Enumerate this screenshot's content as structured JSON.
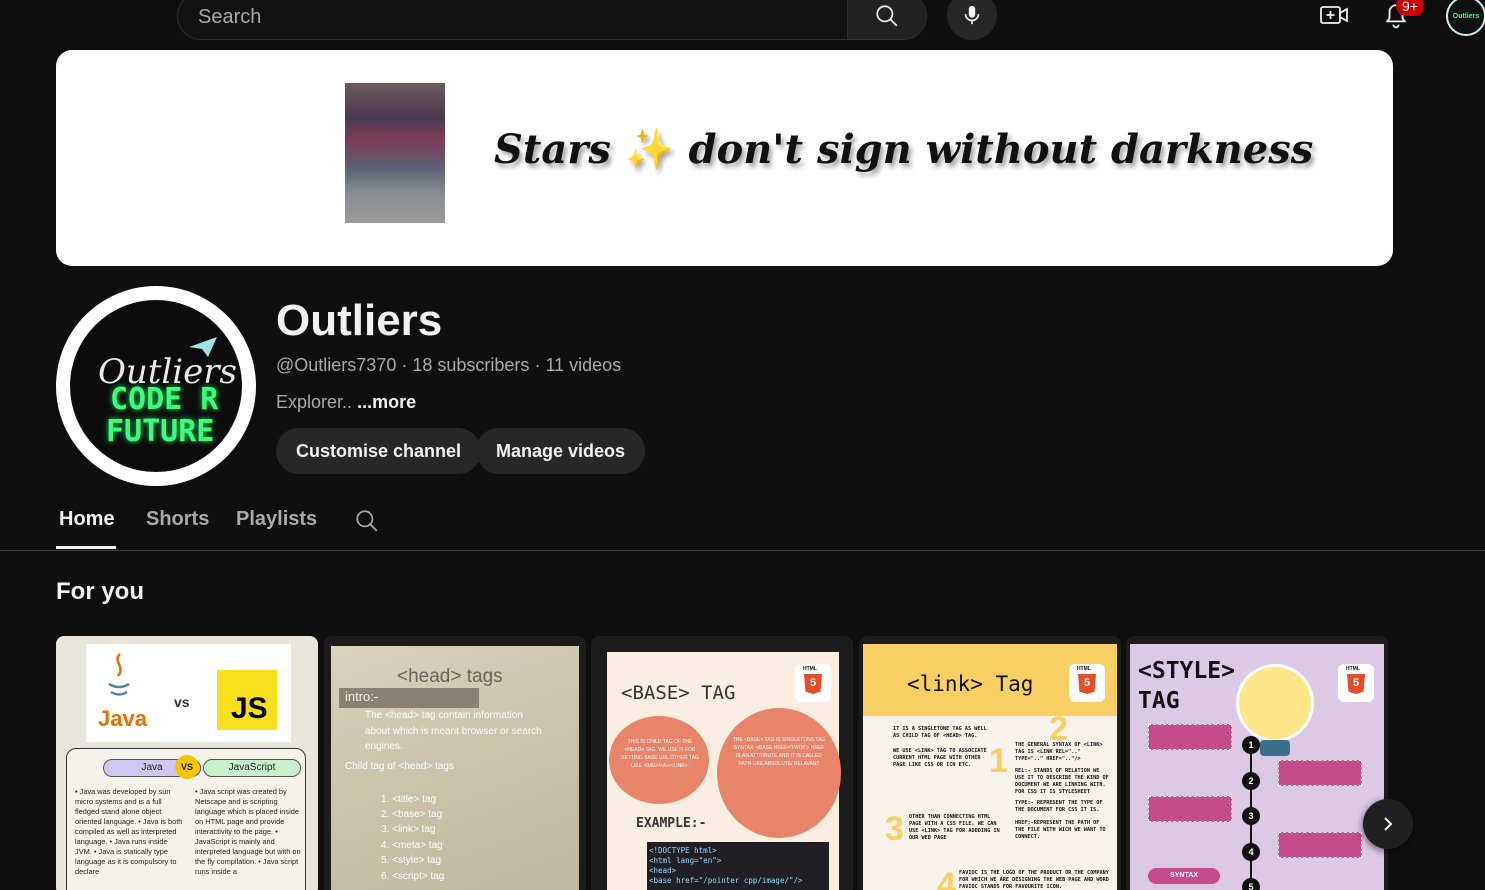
{
  "topbar": {
    "search_placeholder": "Search",
    "notifications_count": "9+",
    "icons": [
      "search-icon",
      "mic-icon",
      "create-video-icon",
      "bell-icon"
    ]
  },
  "banner": {
    "quote_part1": "Stars",
    "quote_emoji": "✨",
    "quote_part2": "don't sign without darkness"
  },
  "channel": {
    "avatar_line1": "Outliers",
    "avatar_line2": "CODE R",
    "avatar_line3": "FUTURE",
    "name": "Outliers",
    "handle": "@Outliers7370",
    "subscribers": "18 subscribers",
    "videos": "11 videos",
    "description": "Explorer..",
    "more_label": "...more",
    "customise_label": "Customise channel",
    "manage_label": "Manage videos"
  },
  "tabs": [
    {
      "label": "Home",
      "active": true
    },
    {
      "label": "Shorts",
      "active": false
    },
    {
      "label": "Playlists",
      "active": false
    }
  ],
  "section": {
    "title": "For you"
  },
  "cards": {
    "c1": {
      "java": "Java",
      "vs": "vs",
      "js": "JS",
      "left_pill": "Java",
      "right_pill": "JavaScript",
      "vs_badge": "VS",
      "left_text": "• Java was developed by sun micro systems and is a full fledged stand alone object oriented language. • Java is both compiled as well as interpreted language. • Java runs inside JVM. • Java is statically type language as it is compulsory to declare",
      "right_text": "• Java script was created by Netscape and is scripting language which is placed inside on HTML page and provide interactivity to the page. • JavaScript is mainly and interpreted language but with on the fly compilation. • Java script runs inside a"
    },
    "c2": {
      "title": "<head> tags",
      "intro": "intro:-",
      "intro_text": "The <head> tag contain information about which is meant browser or search engines.",
      "child_label": "Child tag of <head> tags",
      "items": [
        "1. <title> tag",
        "2. <base> tag",
        "3. <link> tag",
        "4. <meta> tag",
        "5. <style> tag",
        "6. <script> tag"
      ]
    },
    "c3": {
      "title": "<BASE> TAG",
      "bubble1": "THIS IS CHILD TAG OF THE <HEAD> TAG. WE USE IT FOR SETTING BASE URL OTHER TAG LIKE <IMG>/<A>/<LINK>.",
      "bubble2": "THE <BASE> TAG IS SINGLETONS TAG SYNTAX: <BASE HREF=\"PATH\"> HREF IS AN ATTRIBUTE AND IT IS CALLED PATH LIKE ABSOLUTE/ RELAVANT",
      "example": "EXAMPLE:-",
      "code_lines": [
        "<!DOCTYPE html>",
        "<html lang=\"en\">",
        "<head>",
        "    <base href=\"/pointer cpp/image/\"/>"
      ]
    },
    "c4": {
      "title": "<link> Tag",
      "p1": "IT IS A SINGLETONE TAG AS WELL AS CHILD TAG OF <HEAD> TAG.",
      "p2": "WE USE <LINK> TAG TO ASSOCIATE CURRENT HTML PAGE WITH OTHER PAGE LIKE CSS OR ICN ETC.",
      "p3": "THE GENERAL SYNTAX OF <LINK> TAG IS <LINK REL=\"..\" TYPE=\"..\" HREF=\"..\"/>",
      "p4": "REL:- STANDS OF RELATION WE USE IT TO DESCRIBE THE KIND OF DOCUMENT WE ARE LINKING WITH. FOR CSS IT IS STYLESHEET",
      "p5": "TYPE:- REPRESENT THE TYPE OF THE DOCUMENT FOR CSS IT IS.",
      "p6": "HREF:-REPRESENT THE PATH OF THE FILE WITH WICH WE WANT TO CONNECT.",
      "p7": "OTHER THAN CONNECTING HTML PAGE WITH A CSS FILE, WE CAN USE <LINK> TAG FOR ADDDING IN OUR WEB PAGE",
      "p8": "FAVIOC IS THE LOGO OF THE PRODUCT OR THE COMPANY FOR WHICH WE ARE DESIGNING THE WEB PAGE AND WORD FAVIOC STANDS FOR FAVOURITE ICON.",
      "n1": "1",
      "n2": "2",
      "n3": "3",
      "n4": "4"
    },
    "c5": {
      "title_line1": "<STYLE>",
      "title_line2": "TAG",
      "syntax": "SYNTAX",
      "steps": [
        "1",
        "2",
        "3",
        "4",
        "5"
      ]
    },
    "html5_label": "HTML",
    "html5_num": "5"
  }
}
